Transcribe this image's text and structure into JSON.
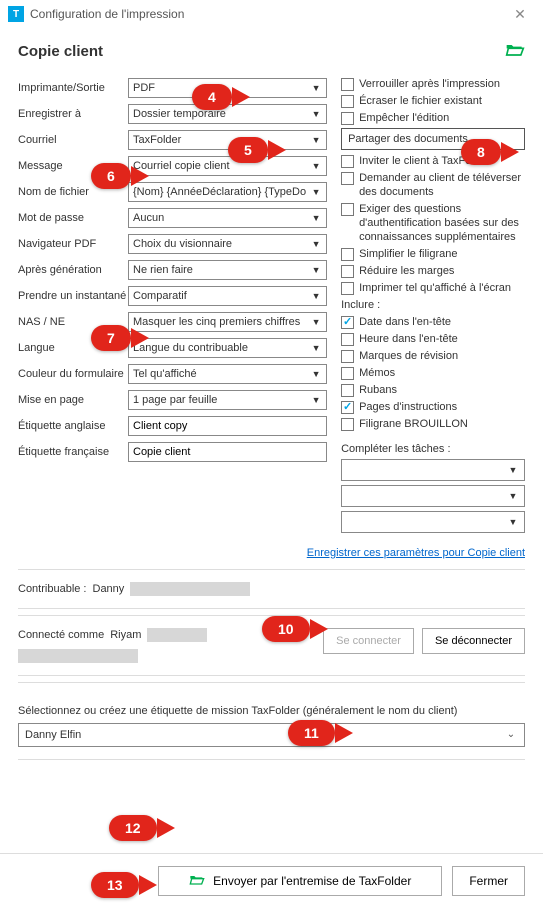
{
  "titlebar": {
    "title": "Configuration de l'impression"
  },
  "header": {
    "title": "Copie client"
  },
  "left": {
    "printer": {
      "label": "Imprimante/Sortie",
      "value": "PDF"
    },
    "saveTo": {
      "label": "Enregistrer à",
      "value": "Dossier temporaire"
    },
    "email": {
      "label": "Courriel",
      "value": "TaxFolder"
    },
    "message": {
      "label": "Message",
      "value": "Courriel copie client"
    },
    "filename": {
      "label": "Nom de fichier",
      "value": "{Nom} {AnnéeDéclaration} {TypeDo"
    },
    "password": {
      "label": "Mot de passe",
      "value": "Aucun"
    },
    "pdfViewer": {
      "label": "Navigateur PDF",
      "value": "Choix du visionnaire"
    },
    "afterGen": {
      "label": "Après génération",
      "value": "Ne rien faire"
    },
    "snapshot": {
      "label": "Prendre un instantané",
      "value": "Comparatif"
    },
    "nas": {
      "label": "NAS / NE",
      "value": "Masquer les cinq premiers chiffres"
    },
    "language": {
      "label": "Langue",
      "value": "Langue du contribuable"
    },
    "formColor": {
      "label": "Couleur du formulaire",
      "value": "Tel qu'affiché"
    },
    "layout": {
      "label": "Mise en page",
      "value": "1 page par feuille"
    },
    "enLabel": {
      "label": "Étiquette anglaise",
      "value": "Client copy"
    },
    "frLabel": {
      "label": "Étiquette française",
      "value": "Copie client"
    }
  },
  "right": {
    "check": {
      "lock": "Verrouiller après l'impression",
      "overwrite": "Écraser le fichier existant",
      "preventEdit": "Empêcher l'édition",
      "shareBtn": "Partager des documents",
      "invite": "Inviter le client à TaxFolder",
      "upload": "Demander au client de téléverser des documents",
      "security": "Exiger des questions d'authentification basées sur des connaissances supplémentaires",
      "simplifyWm": "Simplifier le filigrane",
      "reduceMg": "Réduire les marges",
      "asDisplayed": "Imprimer tel qu'affiché à l'écran",
      "includeLbl": "Inclure :",
      "dateHeader": "Date dans l'en-tête",
      "timeHeader": "Heure dans l'en-tête",
      "revMarks": "Marques de révision",
      "memos": "Mémos",
      "tapes": "Rubans",
      "instrPages": "Pages d'instructions",
      "draftWm": "Filigrane BROUILLON",
      "completeLbl": "Compléter les tâches :"
    }
  },
  "saveLink": "Enregistrer ces paramètres pour Copie client",
  "taxpayerRow": {
    "label": "Contribuable  :",
    "name": "Danny"
  },
  "loginRow": {
    "label": "Connecté comme",
    "name": "Riyam",
    "connect": "Se connecter",
    "disconnect": "Se déconnecter"
  },
  "engagement": {
    "text": "Sélectionnez ou créez une étiquette de mission TaxFolder (généralement le nom du client)",
    "value": "Danny Elfin"
  },
  "footer": {
    "send": "Envoyer par l'entremise de TaxFolder",
    "close": "Fermer"
  },
  "callouts": {
    "c4": "4",
    "c5": "5",
    "c6": "6",
    "c7": "7",
    "c8": "8",
    "c10": "10",
    "c11": "11",
    "c12": "12",
    "c13": "13"
  }
}
